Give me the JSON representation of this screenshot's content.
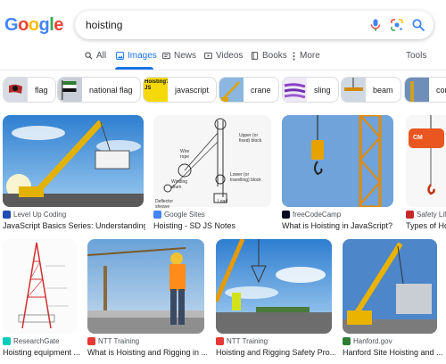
{
  "logo": [
    "G",
    "o",
    "o",
    "g",
    "l",
    "e"
  ],
  "logo_colors": [
    "#4285f4",
    "#ea4335",
    "#fbbc05",
    "#4285f4",
    "#34a853",
    "#ea4335"
  ],
  "search": {
    "query": "hoisting"
  },
  "icons": {
    "mic": "mic-icon",
    "lens": "camera-lens-icon",
    "search": "search-icon"
  },
  "tabs": [
    {
      "label": "All",
      "icon": "search-icon"
    },
    {
      "label": "Images",
      "icon": "image-icon"
    },
    {
      "label": "News",
      "icon": "news-icon"
    },
    {
      "label": "Videos",
      "icon": "play-icon"
    },
    {
      "label": "Books",
      "icon": "book-icon"
    },
    {
      "label": "More",
      "icon": "more-dots-icon"
    }
  ],
  "tools_label": "Tools",
  "accent": "#1a73e8",
  "chips": [
    {
      "label": "flag"
    },
    {
      "label": "national flag"
    },
    {
      "label": "javascript",
      "thumb_text": "Hoisting? JS"
    },
    {
      "label": "crane"
    },
    {
      "label": "sling"
    },
    {
      "label": "beam"
    },
    {
      "label": "con"
    }
  ],
  "results_row1": [
    {
      "source": "Level Up Coding",
      "title": "JavaScript Basics Series: Understanding..."
    },
    {
      "source": "Google Sites",
      "title": "Hoisting - SD JS Notes",
      "labels": [
        "Upper (or fixed) block",
        "Wire rope",
        "Winding drum",
        "Lower (or travelling) block",
        "Deflector sheave",
        "Load"
      ]
    },
    {
      "source": "freeCodeCamp",
      "title": "What is Hoisting in JavaScript?"
    },
    {
      "source": "Safety Lifti",
      "title": "Types of Ho",
      "badge": "CM"
    }
  ],
  "results_row2": [
    {
      "source": "ResearchGate",
      "title": "Hoisting equipment ..."
    },
    {
      "source": "NTT Training",
      "title": "What is Hoisting and Rigging in ..."
    },
    {
      "source": "NTT Training",
      "title": "Hoisting and Rigging Safety Pro..."
    },
    {
      "source": "Hanford.gov",
      "title": "Hanford Site Hoisting and ..."
    }
  ]
}
